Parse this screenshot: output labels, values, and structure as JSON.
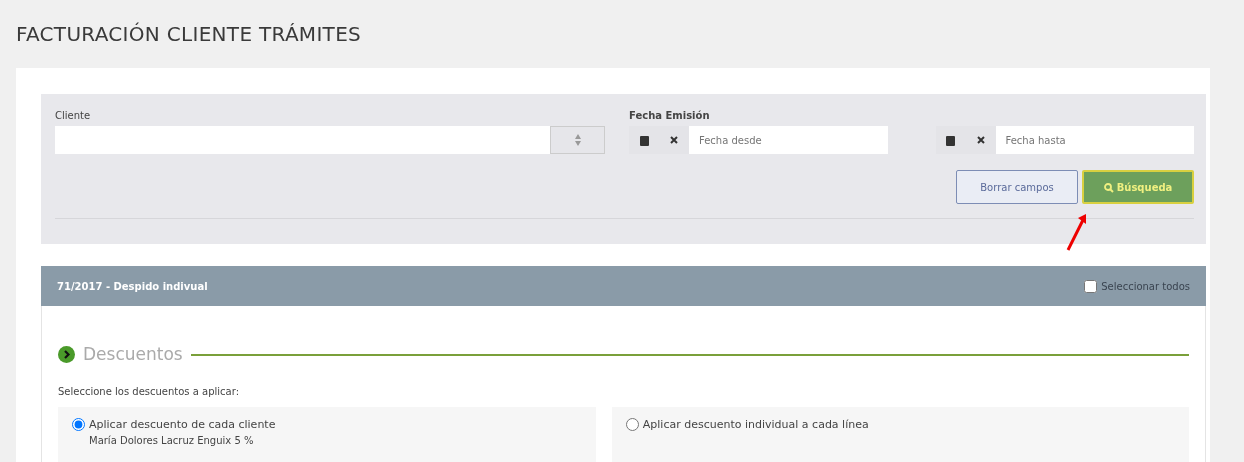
{
  "page": {
    "title": "FACTURACIÓN CLIENTE TRÁMITES"
  },
  "filters": {
    "client_label": "Cliente",
    "date_label": "Fecha Emisión",
    "date_fields": [
      {
        "placeholder": "Fecha desde"
      },
      {
        "placeholder": "Fecha hasta"
      }
    ],
    "buttons": [
      {
        "label": "Borrar campos",
        "kind": "outline"
      },
      {
        "label": "Búsqueda",
        "kind": "search"
      }
    ]
  },
  "case_panel": {
    "title": "71/2017 - Despido indivual",
    "select_all": {
      "label": "Seleccionar todos",
      "checked": false
    }
  },
  "discounts": {
    "heading": "Descuentos",
    "prompt": "Seleccione los descuentos a aplicar:",
    "options": [
      {
        "label": "Aplicar descuento de cada cliente",
        "selected": true,
        "detail": "María Dolores Lacruz Enguix 5 %"
      },
      {
        "label": "Aplicar descuento individual a cada línea",
        "selected": false
      }
    ]
  }
}
